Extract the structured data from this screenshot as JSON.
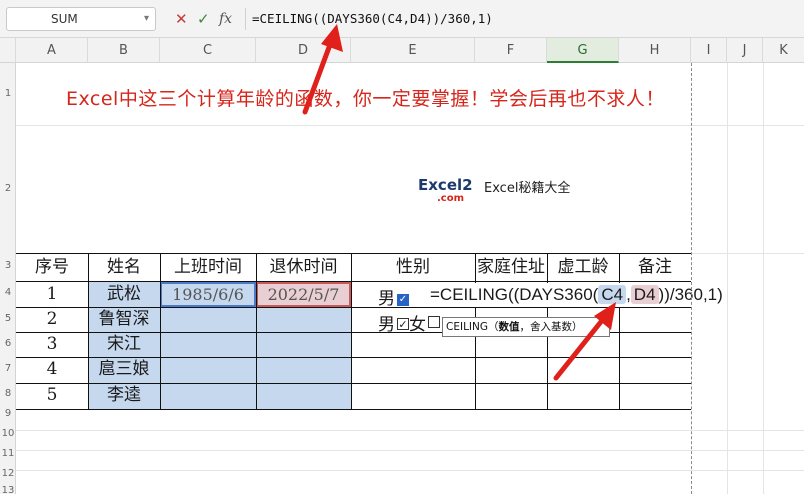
{
  "formula_bar": {
    "name_box": "SUM",
    "cancel_icon": "close-icon",
    "confirm_icon": "check-icon",
    "fx_label": "fx",
    "formula": "=CEILING((DAYS360(C4,D4))/360,1)"
  },
  "columns": [
    "A",
    "B",
    "C",
    "D",
    "E",
    "F",
    "G",
    "H",
    "I",
    "J",
    "K"
  ],
  "rows": [
    "1",
    "2",
    "3",
    "4",
    "5",
    "6",
    "7",
    "8",
    "9",
    "10",
    "11",
    "12",
    "13"
  ],
  "sheet": {
    "title": "Excel中这三个计算年龄的函数，你一定要掌握！学会后再也不求人！",
    "logo_main": "Excel2",
    "logo_sub": ".com",
    "logo_text": "Excel秘籍大全",
    "headers": [
      "序号",
      "姓名",
      "上班时间",
      "退休时间",
      "性别",
      "家庭住址",
      "虚工龄",
      "备注"
    ],
    "data_rows": [
      {
        "no": "1",
        "name": "武松",
        "start": "1985/6/6",
        "end": "2022/5/7"
      },
      {
        "no": "2",
        "name": "鲁智深"
      },
      {
        "no": "3",
        "name": "宋江"
      },
      {
        "no": "4",
        "name": "扈三娘"
      },
      {
        "no": "5",
        "name": "李逵"
      }
    ],
    "gender_row1": "男",
    "gender_row2_male": "男",
    "gender_row2_female": "女",
    "edit_prefix": "=CEILING((DAYS360(",
    "edit_ref1": "C4",
    "edit_comma": ",",
    "edit_ref2": "D4",
    "edit_suffix": "))/360,1)",
    "tooltip_fn": "CEILING（",
    "tooltip_arg1": "数值",
    "tooltip_rest": "，舍入基数）"
  },
  "colors": {
    "accent_red": "#d6261c",
    "selection_blue": "#c5d8ee",
    "selection_pink": "#e9cfd3",
    "checkbox_blue": "#2962c6"
  }
}
